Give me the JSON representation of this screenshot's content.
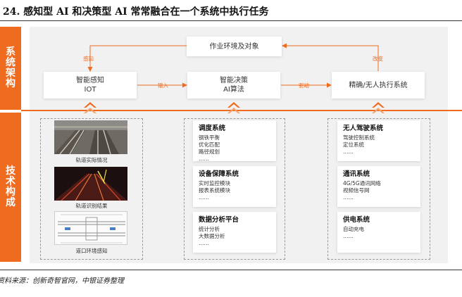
{
  "figure": {
    "title": "24. 感知型 AI 和决策型 AI 常常融合在一个系统中执行任务",
    "source": "资料来源：创新奇智官网，中银证券整理"
  },
  "bands": {
    "architecture": "系统架构",
    "technology": "技术构成"
  },
  "architecture": {
    "environment": "作业环境及对象",
    "perception": {
      "line1": "智能感知",
      "line2": "IOT"
    },
    "decision": {
      "line1": "智能决策",
      "line2": "AI算法"
    },
    "execution": "精确/无人执行系统",
    "edges": {
      "perceive": "感知",
      "input": "输入",
      "drive": "驱动",
      "change": "改变"
    }
  },
  "perception_column": {
    "captions": [
      "轨道实际情况",
      "轨道识别结果",
      "道口环境感知"
    ]
  },
  "decision_column": [
    {
      "title": "调度系统",
      "items": [
        "钢铁平衡",
        "优化匹配",
        "路径规划",
        "……"
      ]
    },
    {
      "title": "设备保障系统",
      "items": [
        "实时监控模块",
        "报表系统模块",
        "……"
      ]
    },
    {
      "title": "数据分析平台",
      "items": [
        "统计分析",
        "大数据分析",
        "……"
      ]
    }
  ],
  "execution_column": [
    {
      "title": "无人驾驶系统",
      "items": [
        "驾驶控制系统",
        "定位系统",
        "……"
      ]
    },
    {
      "title": "通讯系统",
      "items": [
        "4G/5G通讯网络",
        "视频信号网",
        "……"
      ]
    },
    {
      "title": "供电系统",
      "items": [
        "自动充电",
        "……"
      ]
    }
  ],
  "colors": {
    "accent": "#ee6b1f",
    "panel": "#f1f1f1"
  }
}
